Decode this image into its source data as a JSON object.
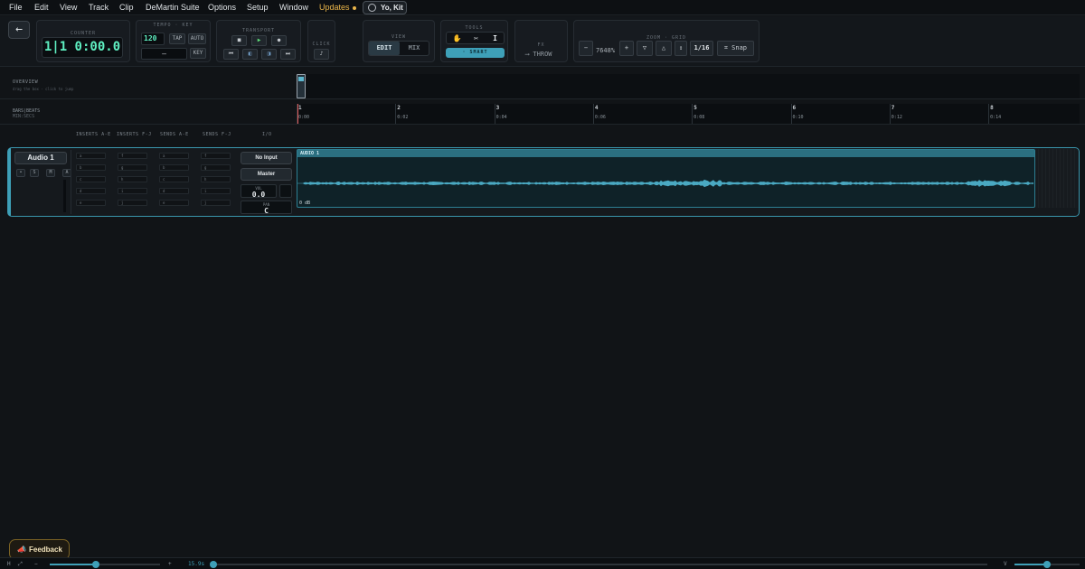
{
  "menu": {
    "items": [
      "File",
      "Edit",
      "View",
      "Track",
      "Clip",
      "DeMartin Suite",
      "Options",
      "Setup",
      "Window"
    ],
    "updates": "Updates",
    "user": "Yo, Kit"
  },
  "toolbar": {
    "back": "←",
    "counter": {
      "label": "COUNTER",
      "value": "1|1 0:00.0"
    },
    "tempo_key": {
      "label": "TEMPO · KEY",
      "tempo": "120",
      "tap": "TAP",
      "auto": "AUTO",
      "key_value": "—",
      "key_btn": "KEY"
    },
    "transport": {
      "label": "TRANSPORT",
      "stop": "■",
      "play": "▶",
      "record": "●",
      "rewind": "⏮",
      "back": "◧",
      "forward": "◨",
      "end": "⏭"
    },
    "click": {
      "label": "CLICK",
      "icon": "♪"
    },
    "view": {
      "label": "VIEW",
      "edit": "EDIT",
      "mix": "MIX"
    },
    "tools": {
      "label": "TOOLS",
      "hand": "✋",
      "scissors": "✂",
      "cursor": "I",
      "smart": "· SMART"
    },
    "fx": {
      "label": "FX",
      "throw": "⟶ THROW"
    },
    "zoom_grid": {
      "label": "ZOOM · GRID",
      "minus": "−",
      "zoom": "7648%",
      "plus": "+",
      "down": "▽",
      "up": "△",
      "fit": "↕",
      "grid": "1/16",
      "snap": "Snap"
    }
  },
  "overview": {
    "title": "OVERVIEW",
    "hint": "drag the box · click to jump"
  },
  "timeline": {
    "label": "BARS|BEATS",
    "sublabel": "MIN:SECS",
    "bars": [
      {
        "num": "1",
        "time": "0:00"
      },
      {
        "num": "2",
        "time": "0:02"
      },
      {
        "num": "3",
        "time": "0:04"
      },
      {
        "num": "4",
        "time": "0:06"
      },
      {
        "num": "5",
        "time": "0:08"
      },
      {
        "num": "6",
        "time": "0:10"
      },
      {
        "num": "7",
        "time": "0:12"
      },
      {
        "num": "8",
        "time": "0:14"
      }
    ]
  },
  "columns": {
    "inserts_ae": "INSERTS A-E",
    "inserts_fj": "INSERTS F-J",
    "sends_ae": "SENDS A-E",
    "sends_fj": "SENDS F-J",
    "io": "I/O"
  },
  "track": {
    "name": "Audio 1",
    "buttons": [
      "•",
      "S",
      "M",
      "A"
    ],
    "inserts_ae": [
      "a",
      "b",
      "c",
      "d",
      "e"
    ],
    "inserts_fj": [
      "f",
      "g",
      "h",
      "i",
      "j"
    ],
    "sends_ae": [
      "a",
      "b",
      "c",
      "d",
      "e"
    ],
    "sends_fj": [
      "f",
      "g",
      "h",
      "i",
      "j"
    ],
    "input": "No Input",
    "output": "Master",
    "vol_label": "VOL",
    "vol": "0.0",
    "pan_label": "PAN",
    "pan": "C",
    "clip_name": "AUDIO 1",
    "clip_gain": "0 dB"
  },
  "status": {
    "h": "H",
    "v": "V",
    "length": "15.9s",
    "plus": "+",
    "minus": "−",
    "h_zoom_fraction": 0.42,
    "v_zoom_fraction": 0.5
  },
  "feedback": "Feedback",
  "colors": {
    "accent": "#3ea0b8",
    "counter": "#5ff0c2",
    "updates": "#e9b54a"
  }
}
